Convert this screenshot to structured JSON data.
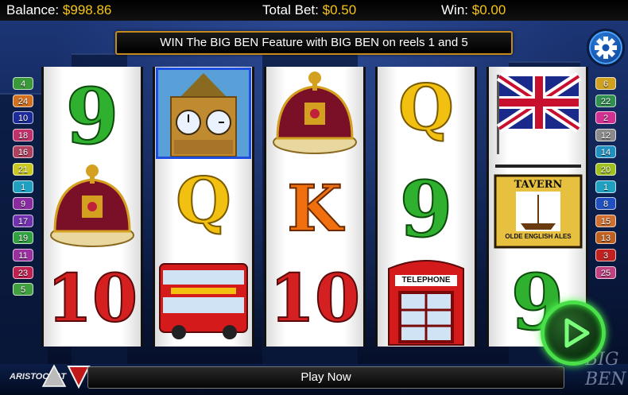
{
  "status": {
    "balance_label": "Balance:",
    "balance_value": "$998.86",
    "bet_label": "Total Bet:",
    "bet_value": "$0.50",
    "win_label": "Win:",
    "win_value": "$0.00"
  },
  "banner": {
    "text": "WIN The BIG BEN Feature with BIG BEN on reels 1 and 5"
  },
  "paylines_left": [
    {
      "n": "4",
      "color": "#3a9a3a"
    },
    {
      "n": "24",
      "color": "#d07020"
    },
    {
      "n": "10",
      "color": "#1a2a9a"
    },
    {
      "n": "18",
      "color": "#c0306a"
    },
    {
      "n": "16",
      "color": "#b04060"
    },
    {
      "n": "21",
      "color": "#c8c820"
    },
    {
      "n": "1",
      "color": "#20a0c0"
    },
    {
      "n": "9",
      "color": "#8a2aa0"
    },
    {
      "n": "17",
      "color": "#7030b0"
    },
    {
      "n": "19",
      "color": "#30a040"
    },
    {
      "n": "11",
      "color": "#9a30a0"
    },
    {
      "n": "23",
      "color": "#c02050"
    },
    {
      "n": "5",
      "color": "#40a040"
    }
  ],
  "paylines_right": [
    {
      "n": "6",
      "color": "#d0a020"
    },
    {
      "n": "22",
      "color": "#309050"
    },
    {
      "n": "2",
      "color": "#d03090"
    },
    {
      "n": "12",
      "color": "#8a8a8a"
    },
    {
      "n": "14",
      "color": "#2090c0"
    },
    {
      "n": "20",
      "color": "#a0c020"
    },
    {
      "n": "1",
      "color": "#20a0c0"
    },
    {
      "n": "8",
      "color": "#2050c0"
    },
    {
      "n": "15",
      "color": "#d07030"
    },
    {
      "n": "13",
      "color": "#c06020"
    },
    {
      "n": "3",
      "color": "#c02020"
    },
    {
      "n": "25",
      "color": "#c04080"
    }
  ],
  "reels": [
    [
      "9",
      "crown",
      "10"
    ],
    [
      "big-ben",
      "Q",
      "bus"
    ],
    [
      "crown",
      "K",
      "10"
    ],
    [
      "Q",
      "9",
      "telephone-box"
    ],
    [
      "union-jack",
      "tavern",
      "9"
    ]
  ],
  "symbol_text": {
    "telephone": "TELEPHONE",
    "tavern": "TAVERN",
    "tavern_sub": "OLDE ENGLISH ALES"
  },
  "footer": {
    "play_label": "Play Now",
    "brand": "ARISTOCRAT",
    "logo": "BIG BEN"
  },
  "colors": {
    "accent": "#f5c518",
    "spin_ring": "#49e04a"
  }
}
